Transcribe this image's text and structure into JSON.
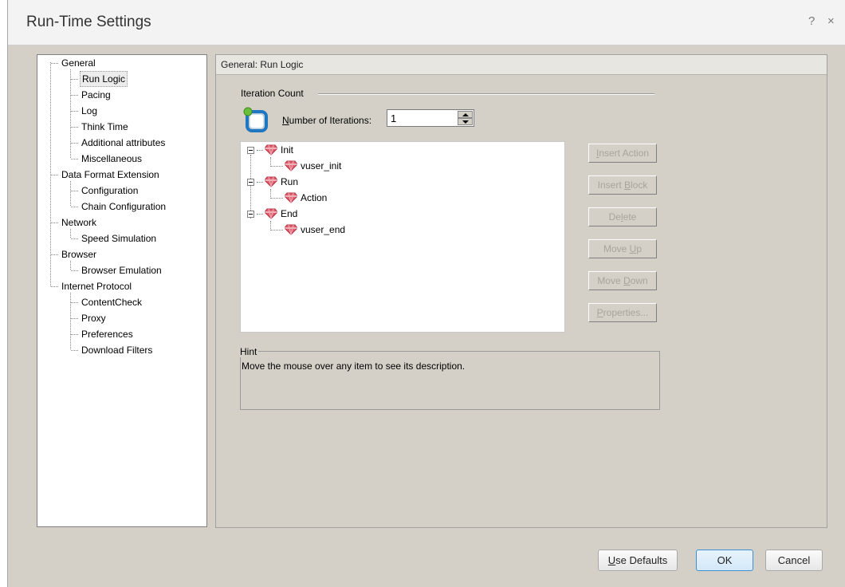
{
  "dialog": {
    "title": "Run-Time Settings",
    "help_icon": "?",
    "close_icon": "×"
  },
  "nav": {
    "items": [
      {
        "label": "General",
        "level": 0
      },
      {
        "label": "Run Logic",
        "level": 1,
        "selected": true
      },
      {
        "label": "Pacing",
        "level": 1
      },
      {
        "label": "Log",
        "level": 1
      },
      {
        "label": "Think Time",
        "level": 1
      },
      {
        "label": "Additional attributes",
        "level": 1
      },
      {
        "label": "Miscellaneous",
        "level": 1
      },
      {
        "label": "Data Format Extension",
        "level": 0
      },
      {
        "label": "Configuration",
        "level": 1
      },
      {
        "label": "Chain Configuration",
        "level": 1
      },
      {
        "label": "Network",
        "level": 0
      },
      {
        "label": "Speed Simulation",
        "level": 1
      },
      {
        "label": "Browser",
        "level": 0
      },
      {
        "label": "Browser Emulation",
        "level": 1
      },
      {
        "label": "Internet Protocol",
        "level": 0
      },
      {
        "label": "ContentCheck",
        "level": 1
      },
      {
        "label": "Proxy",
        "level": 1
      },
      {
        "label": "Preferences",
        "level": 1
      },
      {
        "label": "Download Filters",
        "level": 1
      }
    ]
  },
  "panel": {
    "header": "General: Run Logic",
    "iteration_group": "Iteration Count",
    "iterations_label_prefix": "N",
    "iterations_label_rest": "umber of Iterations:",
    "iterations_value": "1"
  },
  "action_tree": {
    "nodes": [
      {
        "label": "Init",
        "level": 0
      },
      {
        "label": "vuser_init",
        "level": 1
      },
      {
        "label": "Run",
        "level": 0
      },
      {
        "label": "Action",
        "level": 1
      },
      {
        "label": "End",
        "level": 0
      },
      {
        "label": "vuser_end",
        "level": 1
      }
    ]
  },
  "side_buttons": [
    {
      "pre": "",
      "key": "I",
      "post": "nsert Action"
    },
    {
      "pre": "Insert ",
      "key": "B",
      "post": "lock"
    },
    {
      "pre": "De",
      "key": "l",
      "post": "ete"
    },
    {
      "pre": "Move ",
      "key": "U",
      "post": "p"
    },
    {
      "pre": "Move ",
      "key": "D",
      "post": "own"
    },
    {
      "pre": "",
      "key": "P",
      "post": "roperties..."
    }
  ],
  "hint": {
    "title": "Hint",
    "text": "Move the mouse over any item to see its description."
  },
  "footer": {
    "defaults_key": "U",
    "defaults_rest": "se Defaults",
    "ok": "OK",
    "cancel": "Cancel"
  },
  "colors": {
    "dialog_bg": "#d4d0c8",
    "title_bg": "#f3f3f3",
    "ok_border": "#3c8fd0",
    "gem": "#e06070"
  }
}
